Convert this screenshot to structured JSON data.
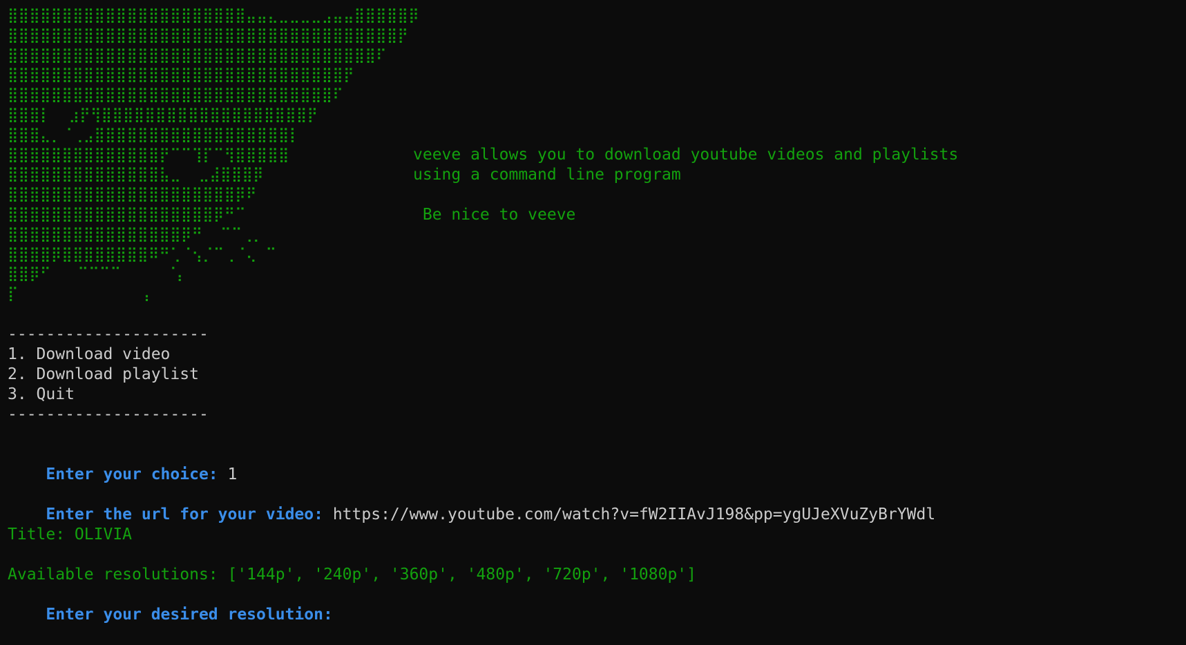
{
  "logo_art": [
    "⣿⣿⣿⣿⣿⣿⣿⣿⣿⣿⣿⣿⣿⣿⣿⣿⣿⣿⣿⣿⣿⣿⣤⣤⣄⣀⣀⣀⣀⣠⣤⣤⣿⣿⣿⣿⣿⡿",
    "⣿⣿⣿⣿⣿⣿⣿⣿⣿⣿⣿⣿⣿⣿⣿⣿⣿⣿⣿⣿⣿⣿⣿⣿⣿⣿⣿⣿⣿⣿⣿⣿⣿⣿⣿⣿⡟",
    "⣿⣿⣿⣿⣿⣿⣿⣿⣿⣿⣿⣿⣿⣿⣿⣿⣿⣿⣿⣿⣿⣿⣿⣿⣿⣿⣿⣿⣿⣿⣿⣿⣿⣿⠏",
    "⣿⣿⣿⣿⣿⣿⣿⣿⣿⣿⣿⣿⣿⣿⣿⣿⣿⣿⣿⣿⣿⣿⣿⣿⣿⣿⣿⣿⣿⣿⣿⡟",
    "⣿⣿⣿⣿⣿⣿⣿⣿⣿⣿⣿⣿⣿⣿⣿⣿⣿⣿⣿⣿⣿⣿⣿⣿⣿⣿⣿⣿⣿⣿⠏",
    "⣿⣿⣿⡇  ⣰⡟⢻⣿⣿⣿⣿⣿⣿⣿⣿⣿⣿⣿⣿⣿⣿⣿⣿⣿⣿⣿⡟",
    "⣿⣿⣿⣄⡀⠈⢀⣠⣿⣿⣿⣿⣿⣿⣿⣿⣿⣿⣿⣿⣿⣿⣿⣿⣿⣿⡇",
    "⣿⣿⣿⣿⣿⣿⣿⣿⣿⣿⣿⣿⣿⣿⡟⠉⠉⢹⡏⠉⢻⣿⣿⣿⣿⣿",
    "⣿⣿⣿⣿⣿⣿⣿⣿⣿⣿⣿⣿⣿⣿⣧⣀  ⣀⣼⣿⣿⣿⡿",
    "⣿⣿⣿⣿⣿⣿⣿⣿⣿⣿⣿⣿⣿⣿⣿⣿⣿⣿⣿⣿⣿⡿⠟",
    "⣿⣿⣿⣿⣿⣿⣿⣿⣿⣿⣿⣿⣿⣿⣿⣿⣿⣿⣿⡿⠛⠉",
    "⣿⣿⣿⣿⣿⣿⣿⣿⣿⣿⣿⣿⣿⣿⣿⣿⡿⠛  ⠉⠉⢀⡀",
    "⣿⣿⣿⣿⡿⣿⣿⣿⣿⣿⣿⣿⣿⠿⠛⢁⠈⢢⡈⠉⢀⠈⢄ ⠉",
    "⣿⣿⡿⠋   ⠉⠉⠉⠉     ⠈⡄",
    "⡏              ⡄"
  ],
  "tagline": {
    "line1": "veeve allows you to download youtube videos and playlists",
    "line2": "using a command line program",
    "line3": " Be nice to veeve"
  },
  "menu": {
    "separator": "---------------------",
    "option1": "1. Download video",
    "option2": "2. Download playlist",
    "option3": "3. Quit"
  },
  "prompts": {
    "choice_label": "Enter your choice:",
    "choice_value": "1",
    "url_label": "Enter the url for your video:",
    "url_value": "https://www.youtube.com/watch?v=fW2IIAvJ198&pp=ygUJeXVuZyBrYWdl",
    "title_line": "Title: OLIVIA",
    "resolutions_line": "Available resolutions: ['144p', '240p', '360p', '480p', '720p', '1080p']",
    "resolution_label": "Enter your desired resolution:"
  },
  "colors": {
    "background": "#0c0c0c",
    "green": "#13a10e",
    "blue": "#3b8eea",
    "white": "#cccccc"
  }
}
